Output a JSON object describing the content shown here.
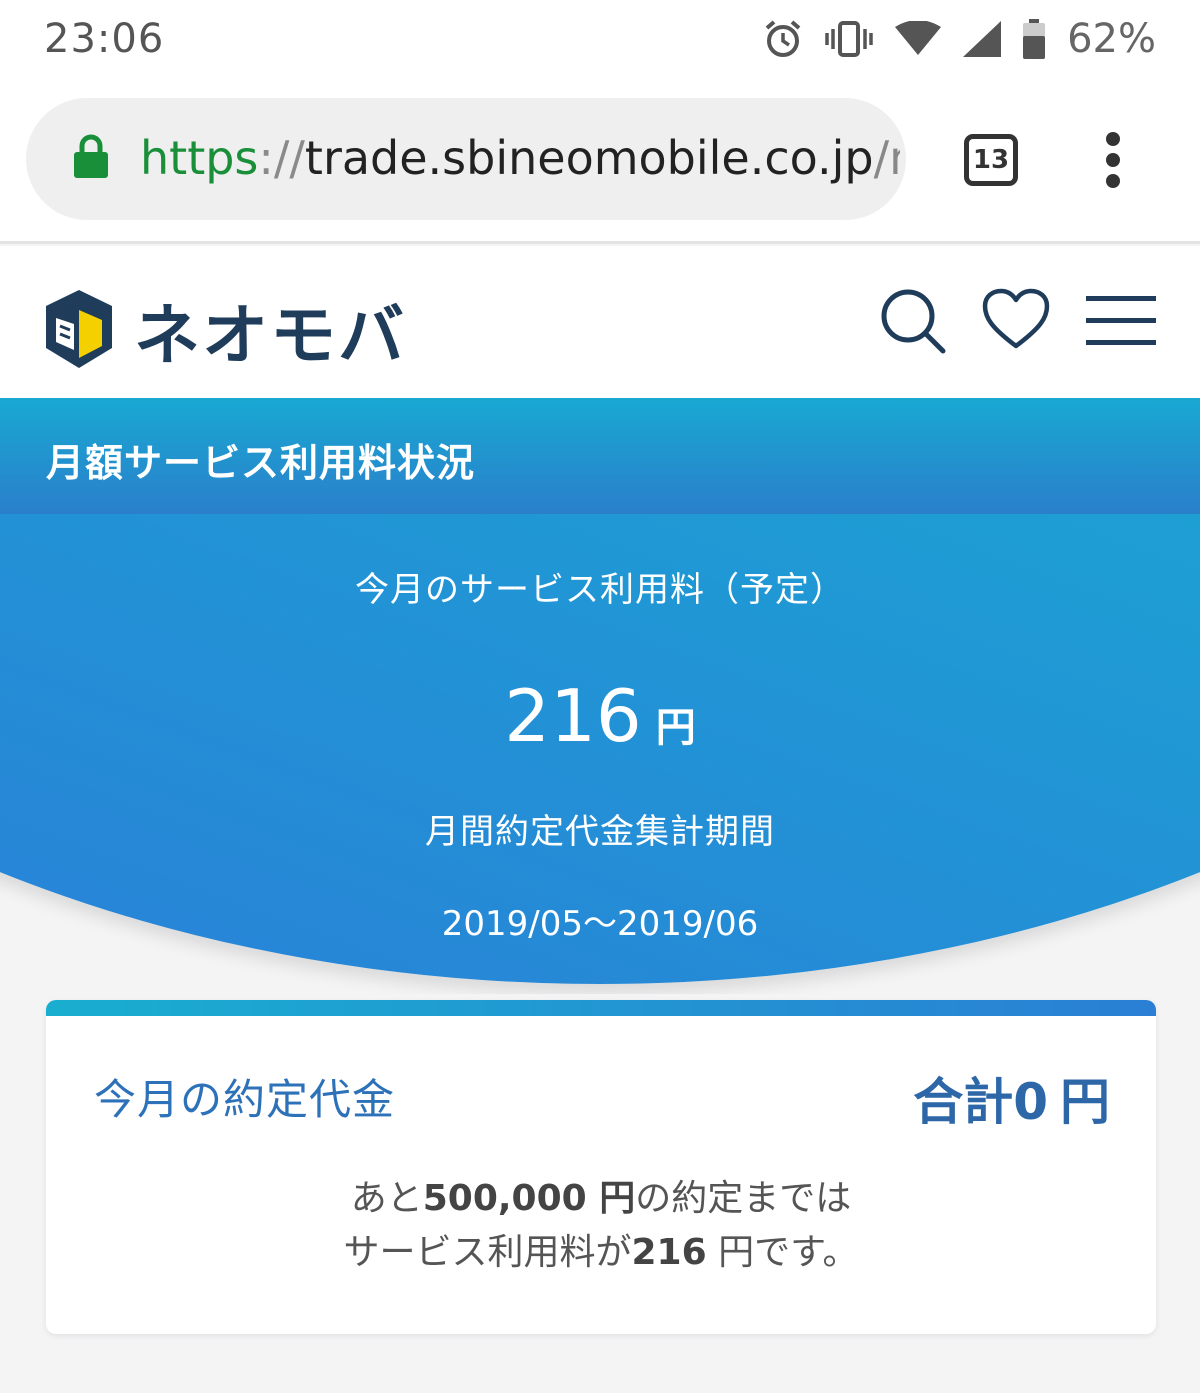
{
  "status_bar": {
    "time": "23:06",
    "battery_percent": "62%",
    "icons": [
      "alarm-icon",
      "vibrate-icon",
      "wifi-icon",
      "signal-icon",
      "battery-icon"
    ]
  },
  "browser": {
    "url_scheme": "https",
    "url_separator": "://",
    "url_host": "trade.sbineomobile.co.jp",
    "url_tail": "/n",
    "tab_count": "13"
  },
  "site": {
    "logo_text": "ネオモバ",
    "icons": [
      "search-icon",
      "heart-icon",
      "hamburger-menu-icon"
    ]
  },
  "section": {
    "heading": "月額サービス利用料状況"
  },
  "hero": {
    "fee_label": "今月のサービス利用料（予定）",
    "fee_amount": "216",
    "fee_unit": "円",
    "period_label": "月間約定代金集計期間",
    "period_value": "2019/05〜2019/06"
  },
  "card": {
    "title": "今月の約定代金",
    "total_prefix": "合計",
    "total_amount": "0",
    "total_unit": "円",
    "msg_line1_pre": "あと",
    "msg_line1_amount": "500,000 円",
    "msg_line1_post": "の約定までは",
    "msg_line2_pre": "サービス利用料が",
    "msg_line2_amount": "216",
    "msg_line2_post": " 円です。"
  },
  "colors": {
    "brand_navy": "#1f3c5b",
    "accent_cyan": "#19a9d2",
    "accent_blue": "#2a7fcb",
    "url_green": "#1a8f3a",
    "logo_yellow": "#f5d000"
  }
}
